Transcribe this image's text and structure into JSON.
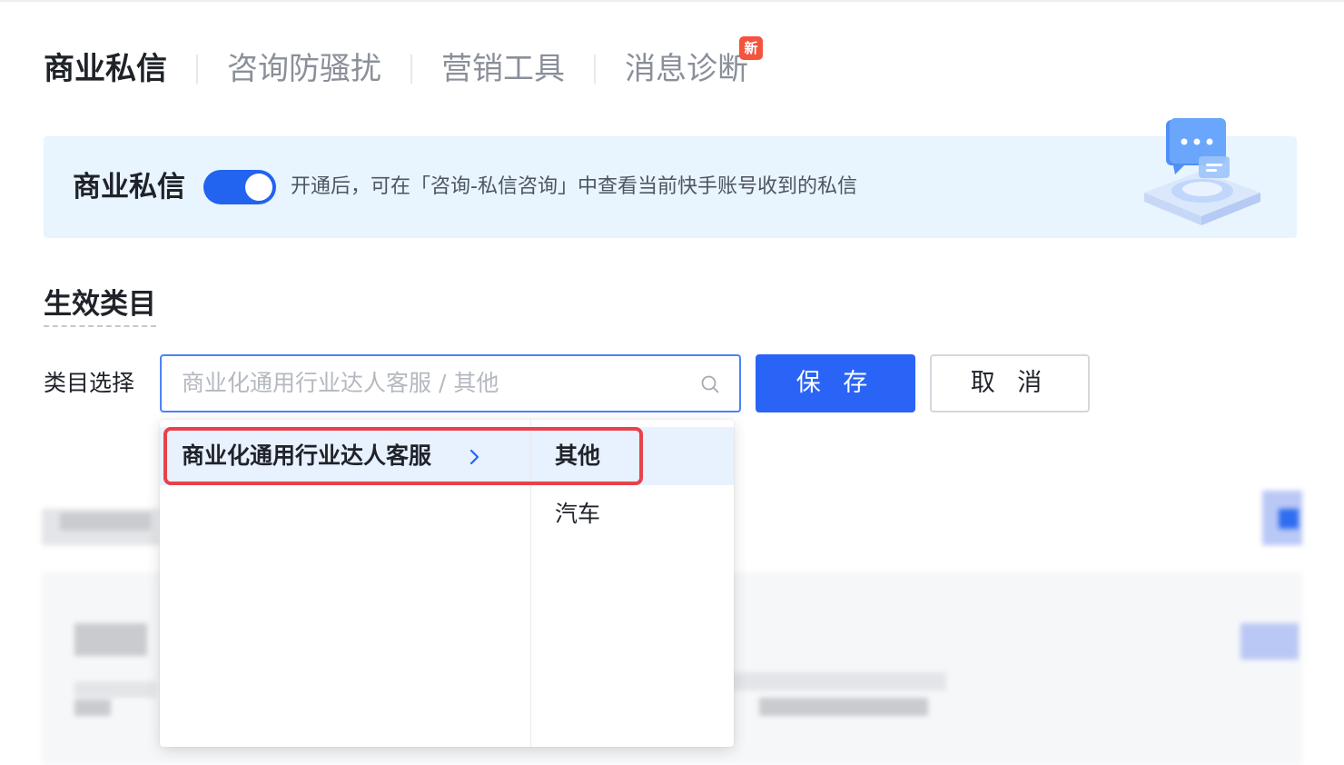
{
  "tabs": [
    {
      "label": "商业私信",
      "active": true
    },
    {
      "label": "咨询防骚扰",
      "active": false
    },
    {
      "label": "营销工具",
      "active": false
    },
    {
      "label": "消息诊断",
      "active": false,
      "badge": "新"
    }
  ],
  "banner": {
    "title": "商业私信",
    "toggle_on": true,
    "description": "开通后，可在「咨询-私信咨询」中查看当前快手账号收到的私信"
  },
  "section": {
    "title": "生效类目"
  },
  "form": {
    "label": "类目选择",
    "cascader_placeholder": "商业化通用行业达人客服 / 其他",
    "save_label": "保 存",
    "cancel_label": "取 消"
  },
  "dropdown": {
    "level1": [
      {
        "label": "商业化通用行业达人客服",
        "active": true
      }
    ],
    "level2": [
      {
        "label": "其他",
        "active": true
      },
      {
        "label": "汽车",
        "active": false
      }
    ]
  },
  "colors": {
    "primary": "#2a64f6",
    "banner_bg": "#e8f4fe",
    "highlight": "#e8424a",
    "badge": "#f4533e"
  }
}
